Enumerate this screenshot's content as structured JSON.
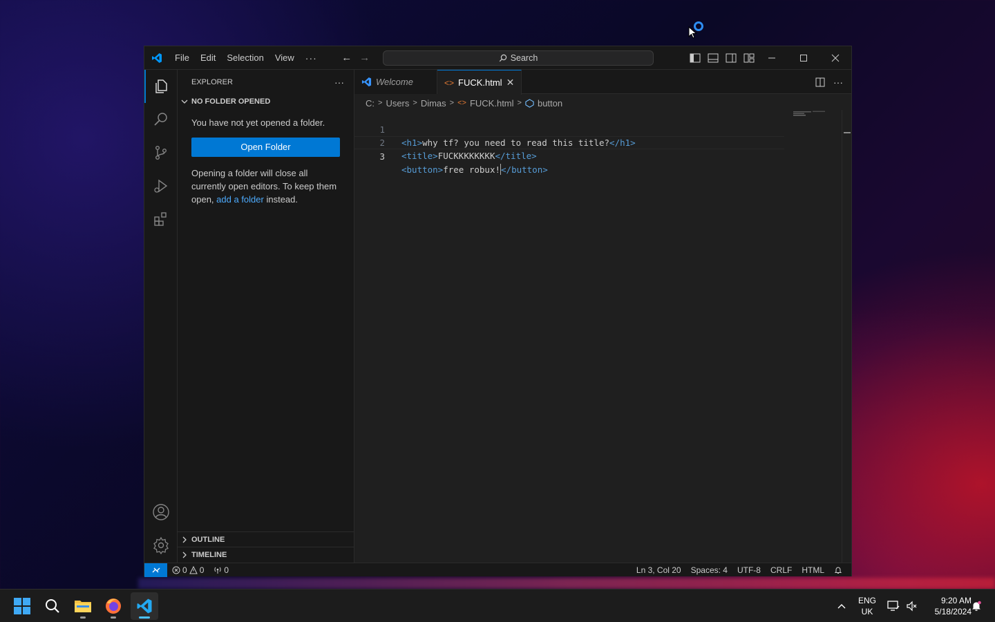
{
  "desktop": {},
  "window": {
    "menu": [
      "File",
      "Edit",
      "Selection",
      "View"
    ],
    "menu_more": "···",
    "search_label": "Search"
  },
  "sidebar": {
    "header": "EXPLORER",
    "header_more": "···",
    "section_title": "NO FOLDER OPENED",
    "no_folder_text": "You have not yet opened a folder.",
    "open_folder_button": "Open Folder",
    "info_prefix": "Opening a folder will close all currently open editors. To keep them open,",
    "info_link": "add a folder",
    "info_suffix": "instead.",
    "outline": "OUTLINE",
    "timeline": "TIMELINE"
  },
  "tabs": [
    {
      "label": "Welcome",
      "active": false
    },
    {
      "label": "FUCK.html",
      "active": true
    }
  ],
  "breadcrumb": [
    "C:",
    "Users",
    "Dimas",
    "FUCK.html",
    "button"
  ],
  "code": {
    "lines": [
      {
        "num": "1",
        "open": "<h1>",
        "text": "why tf? you need to read this title?",
        "close": "</h1>"
      },
      {
        "num": "2",
        "open": "<title>",
        "text": "FUCKKKKKKKK",
        "close": "</title>"
      },
      {
        "num": "3",
        "open": "<button>",
        "text": "free robux!",
        "close": "</button>"
      }
    ],
    "current_line": 3
  },
  "statusbar": {
    "errors": "0",
    "warnings": "0",
    "ports": "0",
    "position": "Ln 3, Col 20",
    "spaces": "Spaces: 4",
    "encoding": "UTF-8",
    "eol": "CRLF",
    "language": "HTML"
  },
  "taskbar": {
    "apps": [
      "windows-start",
      "search",
      "file-explorer",
      "firefox",
      "vscode"
    ],
    "lang_line1": "ENG",
    "lang_line2": "UK",
    "time": "9:20 AM",
    "date": "5/18/2024"
  },
  "colors": {
    "accent": "#0078d4",
    "link": "#4daafc",
    "tag": "#569cd6"
  }
}
